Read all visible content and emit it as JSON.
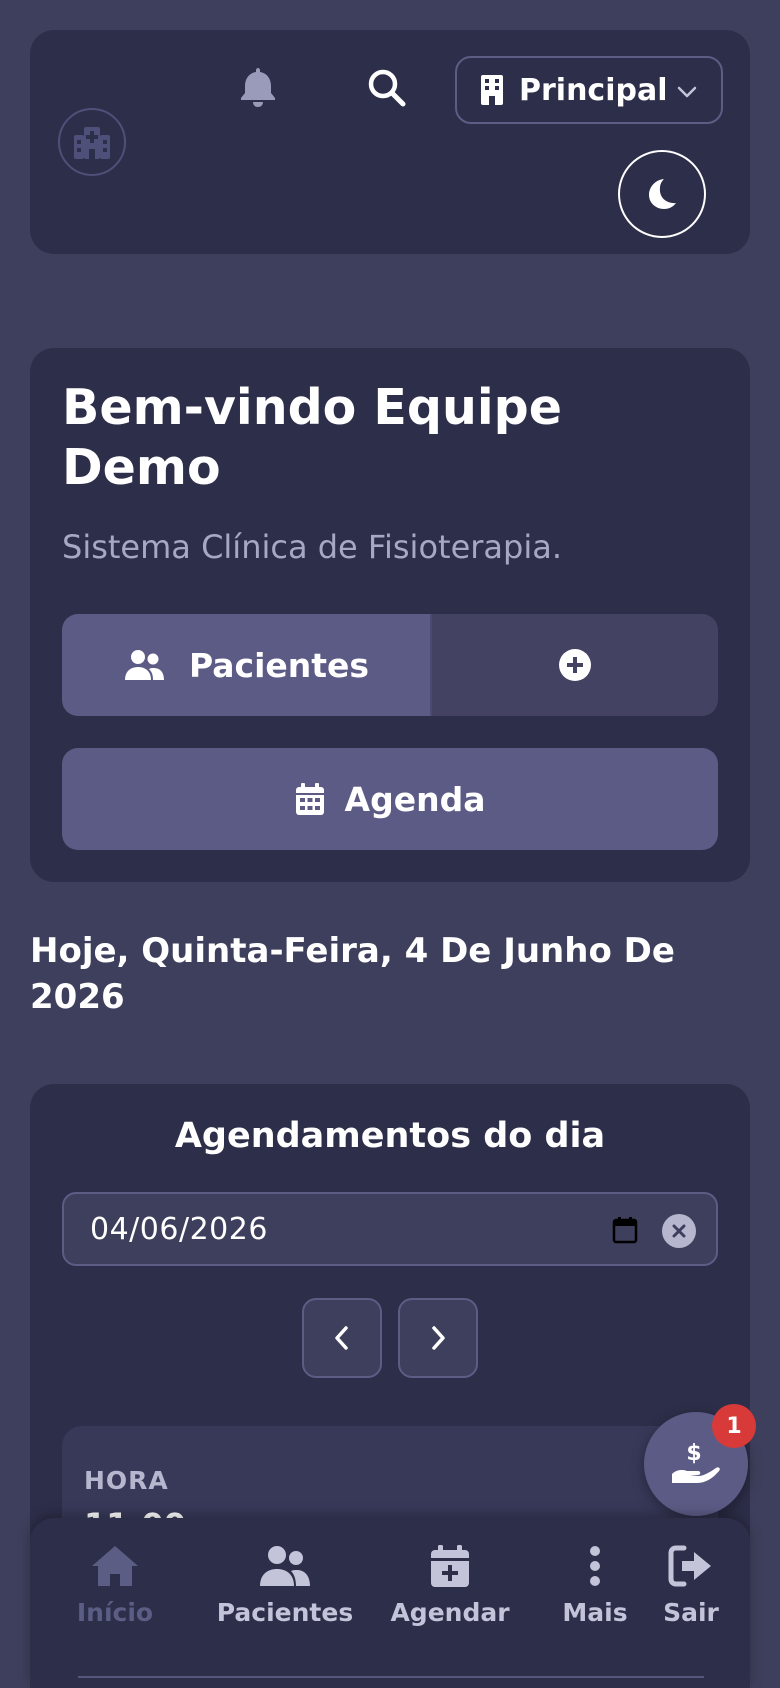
{
  "header": {
    "unit_selector": "Principal"
  },
  "welcome": {
    "title": "Bem-vindo Equipe Demo",
    "subtitle": "Sistema Clínica de Fisioterapia.",
    "patients_label": "Pacientes",
    "agenda_label": "Agenda"
  },
  "today_label": "Hoje, Quinta-Feira, 4 De Junho De 2026",
  "appointments": {
    "title": "Agendamentos do dia",
    "date_value": "04/06/2026",
    "first_item": {
      "time_label": "HORA",
      "time_value": "11:00"
    }
  },
  "finance_badge": "1",
  "bottom_nav": {
    "home": "Início",
    "patients": "Pacientes",
    "schedule": "Agendar",
    "more": "Mais",
    "exit": "Sair"
  },
  "colors": {
    "background": "#3e3f5c",
    "card": "#2d2e49",
    "accent": "#5c5b85",
    "badge": "#d83a3a",
    "muted_text": "#a7a8c6"
  },
  "icons": {
    "logo": "hospital-icon",
    "notifications": "bell-icon",
    "search": "search-icon",
    "unit": "building-icon",
    "theme": "moon-icon",
    "patients": "users-icon",
    "add": "plus-circle-icon",
    "agenda": "calendar-icon",
    "finance": "hand-money-icon",
    "home": "home-icon",
    "schedule": "calendar-plus-icon",
    "more": "ellipsis-vertical-icon",
    "exit": "sign-out-icon"
  }
}
